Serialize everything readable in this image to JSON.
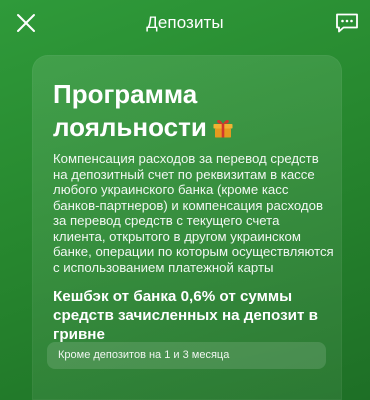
{
  "header": {
    "title": "Депозиты",
    "close_icon": "close-icon",
    "chat_icon": "chat-icon"
  },
  "card": {
    "title": "Программа лояльности",
    "title_icon": "gift-icon",
    "description": "Компенсация расходов за перевод средств на депозитный счет по реквизитам в кассе любого украинского банка (кроме касс банков-партнеров) и компенсация расходов за перевод средств с текущего счета клиента, открытого в другом украинском банке, операции по которым осуществляются с использованием платежной карты",
    "cashback": "Кешбэк от банка 0,6% от суммы средств зачисленных на депозит в гривне",
    "note": "Кроме депозитов на 1 и 3 месяца"
  },
  "colors": {
    "background": "#27882f",
    "text": "#ffffff"
  }
}
